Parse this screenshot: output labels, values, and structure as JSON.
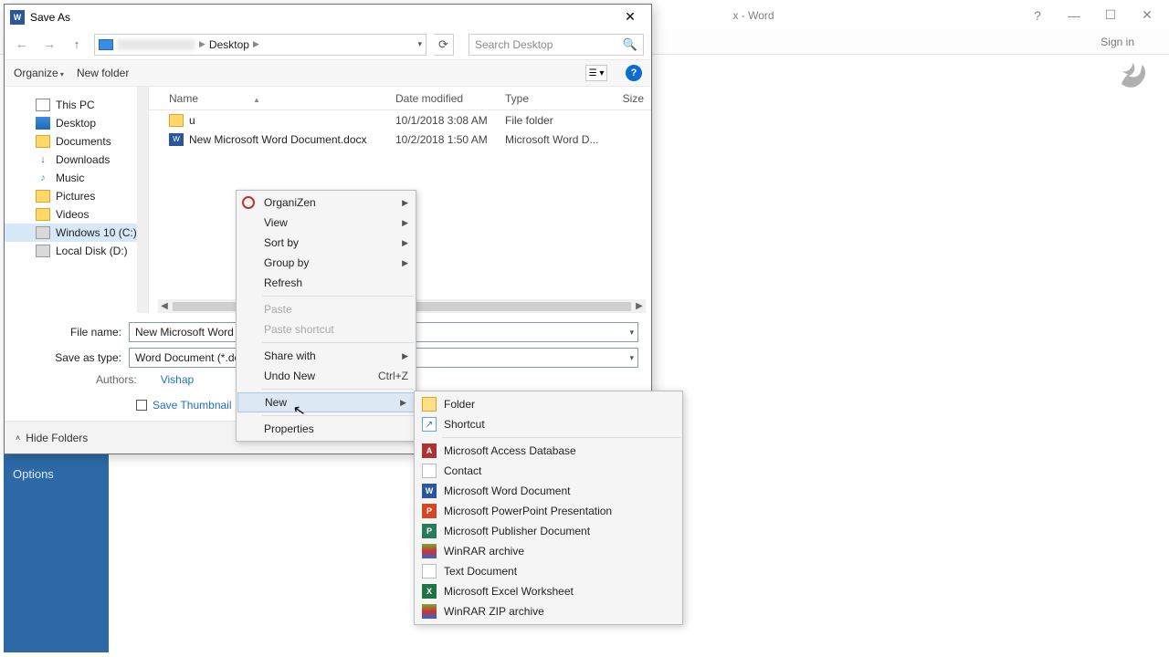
{
  "word": {
    "title_suffix": "x - Word",
    "signin": "Sign in",
    "options_stub": "Options"
  },
  "dialog": {
    "title": "Save As",
    "breadcrumb": {
      "location": "Desktop"
    },
    "search_placeholder": "Search Desktop",
    "toolbar": {
      "organize": "Organize",
      "new_folder": "New folder"
    },
    "tree": [
      {
        "label": "This PC",
        "icon": "pc"
      },
      {
        "label": "Desktop",
        "icon": "desktop"
      },
      {
        "label": "Documents",
        "icon": "folder"
      },
      {
        "label": "Downloads",
        "icon": "down"
      },
      {
        "label": "Music",
        "icon": "music"
      },
      {
        "label": "Pictures",
        "icon": "folder"
      },
      {
        "label": "Videos",
        "icon": "folder"
      },
      {
        "label": "Windows 10 (C:)",
        "icon": "drive",
        "selected": true
      },
      {
        "label": "Local Disk (D:)",
        "icon": "drive"
      }
    ],
    "columns": {
      "name": "Name",
      "date": "Date modified",
      "type": "Type",
      "size": "Size"
    },
    "rows": [
      {
        "name": "u",
        "date": "10/1/2018 3:08 AM",
        "type": "File folder",
        "icon": "folder"
      },
      {
        "name": "New Microsoft Word Document.docx",
        "date": "10/2/2018 1:50 AM",
        "type": "Microsoft Word D...",
        "icon": "word"
      }
    ],
    "filename_lbl": "File name:",
    "filename_val": "New Microsoft Word",
    "saveastype_lbl": "Save as type:",
    "saveastype_val": "Word Document (*.do",
    "authors_lbl": "Authors:",
    "authors_val": "Vishap",
    "save_thumbnail": "Save Thumbnail",
    "hide_folders": "Hide Folders"
  },
  "ctx": {
    "organizen": "OrganiZen",
    "view": "View",
    "sort_by": "Sort by",
    "group_by": "Group by",
    "refresh": "Refresh",
    "paste": "Paste",
    "paste_shortcut": "Paste shortcut",
    "share_with": "Share with",
    "undo_new": "Undo New",
    "undo_kb": "Ctrl+Z",
    "new": "New",
    "properties": "Properties"
  },
  "submenu": {
    "folder": "Folder",
    "shortcut": "Shortcut",
    "access": "Microsoft Access Database",
    "contact": "Contact",
    "word": "Microsoft Word Document",
    "ppt": "Microsoft PowerPoint Presentation",
    "pub": "Microsoft Publisher Document",
    "rar": "WinRAR archive",
    "txt": "Text Document",
    "excel": "Microsoft Excel Worksheet",
    "zip": "WinRAR ZIP archive"
  }
}
